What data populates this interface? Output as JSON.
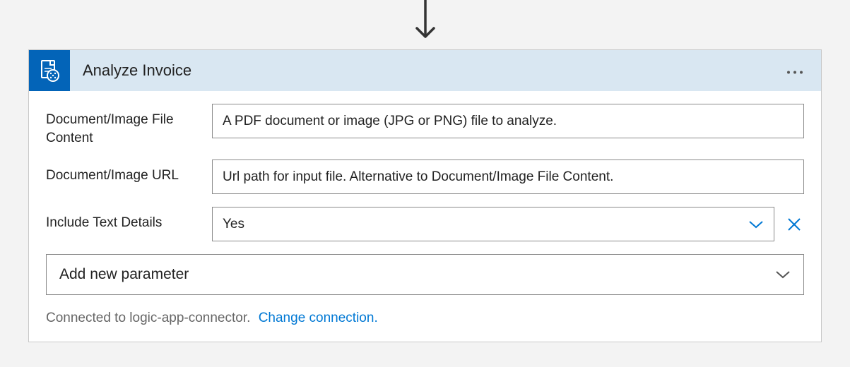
{
  "header": {
    "title": "Analyze Invoice",
    "icon": "document-analyze-icon"
  },
  "fields": [
    {
      "label": "Document/Image File Content",
      "placeholder": "A PDF document or image (JPG or PNG) file to analyze.",
      "value": "",
      "type": "text"
    },
    {
      "label": "Document/Image URL",
      "placeholder": "Url path for input file. Alternative to Document/Image File Content.",
      "value": "",
      "type": "text"
    },
    {
      "label": "Include Text Details",
      "value": "Yes",
      "type": "select",
      "clearable": true
    }
  ],
  "add_param_label": "Add new parameter",
  "footer": {
    "connected_text": "Connected to logic-app-connector.",
    "change_link": "Change connection."
  },
  "colors": {
    "accent": "#0078d4",
    "header_bg": "#d9e7f2",
    "icon_bg": "#0364b8"
  }
}
